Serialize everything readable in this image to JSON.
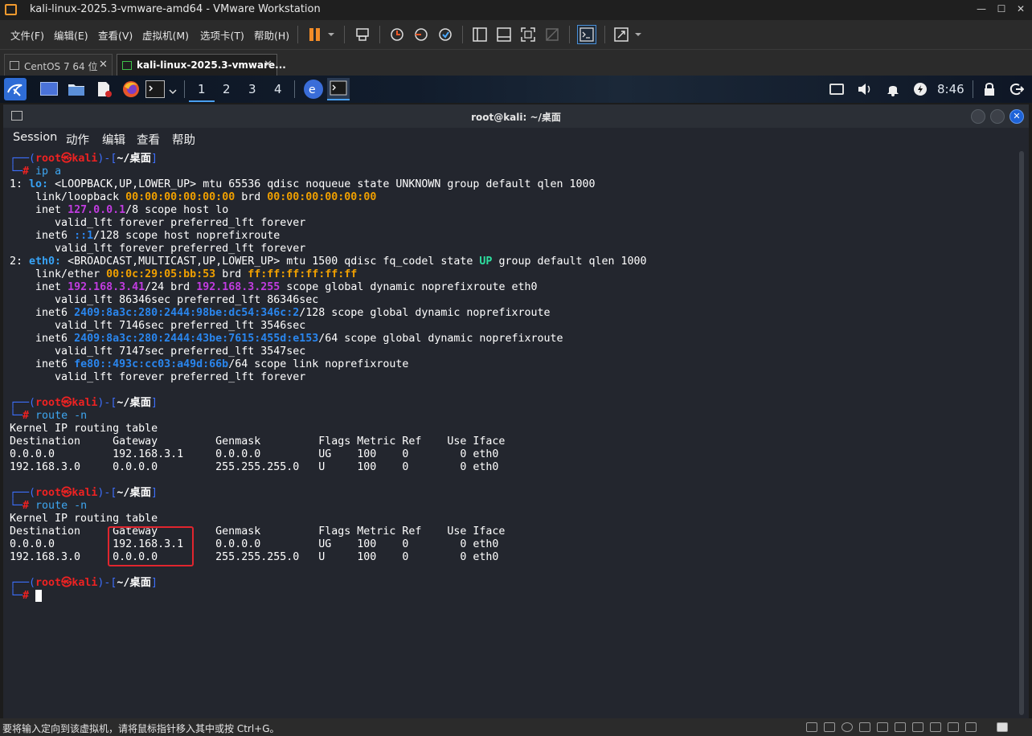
{
  "window": {
    "title": "kali-linux-2025.3-vmware-amd64 - VMware Workstation",
    "minimize": "—",
    "maximize": "☐",
    "close": "✕"
  },
  "menu": [
    "文件(F)",
    "编辑(E)",
    "查看(V)",
    "虚拟机(M)",
    "选项卡(T)",
    "帮助(H)"
  ],
  "tabs": [
    {
      "label": "CentOS 7 64 位",
      "active": false
    },
    {
      "label": "kali-linux-2025.3-vmware...",
      "active": true
    }
  ],
  "kali_panel": {
    "workspaces": [
      "1",
      "2",
      "3",
      "4"
    ],
    "active_workspace": "1",
    "clock": "8:46"
  },
  "terminal": {
    "title": "root@kali: ~/桌面",
    "menu": [
      "Session",
      "动作",
      "编辑",
      "查看",
      "帮助"
    ],
    "prompt": {
      "user": "root",
      "host": "kali",
      "at": "㉿",
      "dir": "~/桌面",
      "hash": "#"
    },
    "cmd1": "ip a",
    "ipa": {
      "l1a": "1: ",
      "lo": "lo:",
      "l1b": " <LOOPBACK,UP,LOWER_UP> mtu 65536 qdisc noqueue state UNKNOWN group default qlen 1000",
      "l2a": "    link/loopback ",
      "lomac": "00:00:00:00:00:00",
      "l2b": " brd ",
      "lobrd": "00:00:00:00:00:00",
      "l3a": "    inet ",
      "loip": "127.0.0.1",
      "l3b": "/8 scope host lo",
      "l4": "       valid_lft forever preferred_lft forever",
      "l5a": "    inet6 ",
      "loip6": "::1",
      "l5b": "/128 scope host noprefixroute",
      "l6": "       valid_lft forever preferred_lft forever",
      "l7a": "2: ",
      "eth": "eth0:",
      "l7b": " <BROADCAST,MULTICAST,UP,LOWER_UP> mtu 1500 qdisc fq_codel state ",
      "up": "UP",
      "l7c": " group default qlen 1000",
      "l8a": "    link/ether ",
      "ethmac": "00:0c:29:05:bb:53",
      "l8b": " brd ",
      "ethbrd": "ff:ff:ff:ff:ff:ff",
      "l9a": "    inet ",
      "ethip": "192.168.3.41",
      "l9b": "/24 brd ",
      "ethbcast": "192.168.3.255",
      "l9c": " scope global dynamic noprefixroute eth0",
      "l10": "       valid_lft 86346sec preferred_lft 86346sec",
      "l11a": "    inet6 ",
      "ip6a": "2409:8a3c:280:2444:98be:dc54:346c:2",
      "l11b": "/128 scope global dynamic noprefixroute",
      "l12": "       valid_lft 7146sec preferred_lft 3546sec",
      "l13a": "    inet6 ",
      "ip6b": "2409:8a3c:280:2444:43be:7615:455d:e153",
      "l13b": "/64 scope global dynamic noprefixroute",
      "l14": "       valid_lft 7147sec preferred_lft 3547sec",
      "l15a": "    inet6 ",
      "ip6c": "fe80::493c:cc03:a49d:66b",
      "l15b": "/64 scope link noprefixroute",
      "l16": "       valid_lft forever preferred_lft forever"
    },
    "cmd2": "route -n",
    "route": {
      "t": "Kernel IP routing table",
      "h": "Destination     Gateway         Genmask         Flags Metric Ref    Use Iface",
      "r1": "0.0.0.0         192.168.3.1     0.0.0.0         UG    100    0        0 eth0",
      "r2": "192.168.3.0     0.0.0.0         255.255.255.0   U     100    0        0 eth0"
    }
  },
  "status_bar": {
    "text": "要将输入定向到该虚拟机，请将鼠标指针移入其中或按 Ctrl+G。"
  }
}
